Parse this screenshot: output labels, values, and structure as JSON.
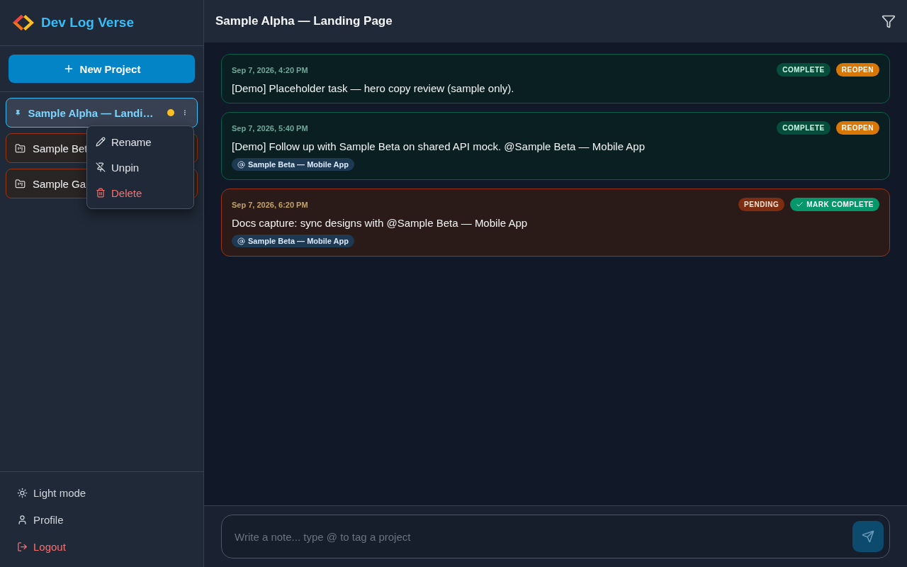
{
  "app": {
    "name": "Dev Log Verse"
  },
  "new_project_button": "New Project",
  "projects": [
    {
      "name": "Sample Alpha — Landi…",
      "selected": true,
      "pinned": true,
      "has_activity": true
    },
    {
      "name": "Sample Bet",
      "selected": false,
      "pinned": false
    },
    {
      "name": "Sample Ga",
      "selected": false,
      "pinned": false
    }
  ],
  "project_menu": [
    {
      "label": "Rename",
      "kind": "rename"
    },
    {
      "label": "Unpin",
      "kind": "unpin"
    },
    {
      "label": "Delete",
      "kind": "delete"
    }
  ],
  "sidebar_footer": [
    {
      "label": "Light mode",
      "kind": "theme"
    },
    {
      "label": "Profile",
      "kind": "profile"
    },
    {
      "label": "Logout",
      "kind": "logout"
    }
  ],
  "header": {
    "title": "Sample Alpha — Landing Page"
  },
  "notes": [
    {
      "time": "Sep 7, 2026, 4:20 PM",
      "kind": "complete",
      "status_label": "COMPLETE",
      "action": "REOPEN",
      "text": "[Demo] Placeholder task — hero copy review (sample only)."
    },
    {
      "time": "Sep 7, 2026, 5:40 PM",
      "kind": "complete",
      "status_label": "COMPLETE",
      "action": "REOPEN",
      "text": "[Demo] Follow up with Sample Beta on shared API mock. @Sample Beta — Mobile App",
      "tags": [
        "Sample Beta — Mobile App"
      ]
    },
    {
      "time": "Sep 7, 2026, 6:20 PM",
      "kind": "pending",
      "status_label": "PENDING",
      "action": "MARK COMPLETE",
      "text": "Docs capture: sync designs with @Sample Beta — Mobile App",
      "tags": [
        "Sample Beta — Mobile App"
      ]
    }
  ],
  "composer": {
    "placeholder": "Write a note... type @ to tag a project"
  }
}
